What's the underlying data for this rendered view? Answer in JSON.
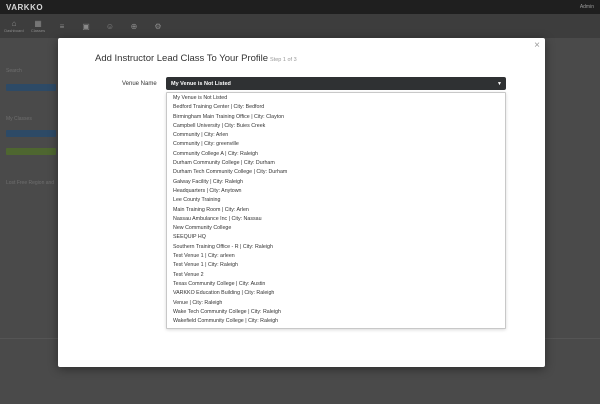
{
  "app": {
    "logo": "VARKKO"
  },
  "header": {
    "right_items": [
      "",
      "",
      "Admin"
    ]
  },
  "nav": {
    "items": [
      {
        "icon": "home-icon",
        "label": "Dashboard"
      },
      {
        "icon": "calendar-icon",
        "label": "Classes"
      },
      {
        "icon": "list-icon",
        "label": ""
      },
      {
        "icon": "briefcase-icon",
        "label": ""
      },
      {
        "icon": "people-icon",
        "label": ""
      },
      {
        "icon": "plus-icon",
        "label": ""
      },
      {
        "icon": "gear-icon",
        "label": ""
      }
    ]
  },
  "background": {
    "left_labels": [
      "Search",
      "My Classes",
      "Lost Free Region and"
    ],
    "accent_blue": "#2d77b8",
    "accent_green": "#6b9d3a"
  },
  "modal": {
    "title": "Add Instructor Lead Class To Your Profile",
    "step": "Step 1 of 3",
    "close": "×",
    "venue_label": "Venue Name",
    "selected": "My Venue is Not Listed",
    "options": [
      "My Venue is Not Listed",
      "Bedford Training Center | City: Bedford",
      "Birmingham Main Training Office | City: Clayton",
      "Campbell University | City: Buies Creek",
      "Community | City: Arlen",
      "Community | City: greenville",
      "Community College A | City: Raleigh",
      "Durham Community College | City: Durham",
      "Durham Tech Community College | City: Durham",
      "Galway Facility | City: Raleigh",
      "Headquarters | City: Anytown",
      "Lee County Training",
      "Main Training Room | City: Arlen",
      "Nassau Ambulance Inc | City: Nassau",
      "New Community College",
      "SEEQUIP HQ",
      "Southern Training Office - R | City: Raleigh",
      "Test Venue 1 | City: arleen",
      "Test Venue 1 | City: Raleigh",
      "Test Venue 2",
      "Texas Community College | City: Austin",
      "VARKKO Education Building | City: Raleigh",
      "Venue | City: Raleigh",
      "Wake Tech Community College | City: Raleigh",
      "Wakefield Community College | City: Raleigh"
    ]
  }
}
